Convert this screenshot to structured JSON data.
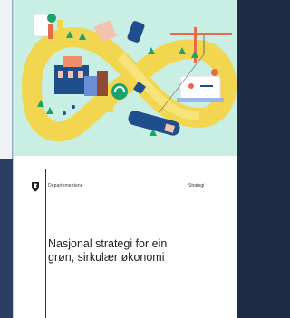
{
  "document": {
    "publisher": "Departementene",
    "doc_type": "Strategi",
    "title_line_1": "Nasjonal strategi for ein",
    "title_line_2": "grøn, sirkulær økonomi"
  },
  "colors": {
    "background_mint": "#c9efe5",
    "loop_yellow": "#f2d64f",
    "page_white": "#ffffff",
    "frame_navy": "#243455"
  },
  "icons": [
    "crest-icon",
    "recycle-icon"
  ]
}
